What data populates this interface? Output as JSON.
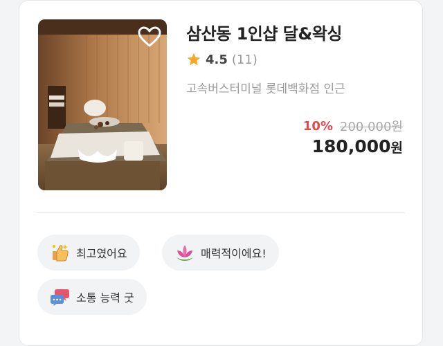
{
  "listing": {
    "title": "삼산동 1인샵 달&왁싱",
    "rating": "4.5",
    "review_count": "(11)",
    "location": "고속버스터미널 롯데백화점 인근",
    "discount": "10%",
    "original_price": "200,000원",
    "final_price": "180,000",
    "currency_unit": "원",
    "favorited": false
  },
  "tags": [
    {
      "label": "최고였어요",
      "icon": "thumbs-up-sparkle-icon"
    },
    {
      "label": "매력적이에요!",
      "icon": "lotus-icon"
    },
    {
      "label": "소통 능력 굿",
      "icon": "speech-bubbles-icon"
    }
  ],
  "colors": {
    "discount": "#e5484d",
    "star": "#f5a623",
    "muted": "#9a9a9a"
  }
}
